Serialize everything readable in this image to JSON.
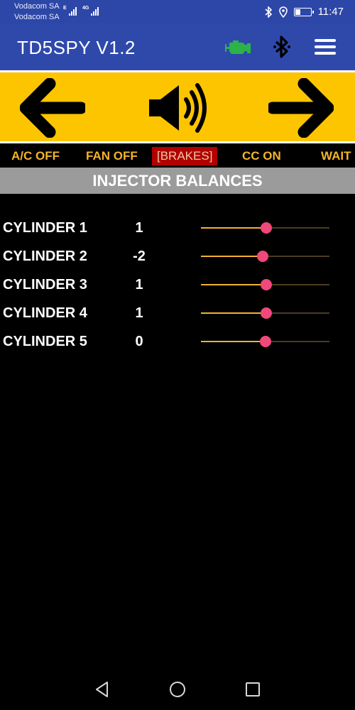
{
  "status_bar": {
    "carrier1": "Vodacom SA",
    "carrier2": "Vodacom SA",
    "network1": "E",
    "network2": "4G",
    "time": "11:47"
  },
  "app_bar": {
    "title": "TD5SPY V1.2",
    "engine_icon": "engine-check-icon",
    "bluetooth_icon": "bluetooth-icon",
    "menu_icon": "hamburger-menu-icon"
  },
  "controls": {
    "left": "left-arrow-icon",
    "sound": "speaker-icon",
    "right": "right-arrow-icon",
    "background": "#fdc500"
  },
  "toggles": [
    {
      "label": "A/C OFF",
      "active": false
    },
    {
      "label": "FAN OFF",
      "active": false
    },
    {
      "label": "[BRAKES]",
      "active": true
    },
    {
      "label": "CC ON",
      "active": false
    },
    {
      "label": "WAIT",
      "active": false
    }
  ],
  "section": {
    "title": "INJECTOR BALANCES"
  },
  "cylinders": [
    {
      "label": "CYLINDER 1",
      "value": "1",
      "slider_level": 0.51
    },
    {
      "label": "CYLINDER 2",
      "value": "-2",
      "slider_level": 0.48
    },
    {
      "label": "CYLINDER 3",
      "value": "1",
      "slider_level": 0.51
    },
    {
      "label": "CYLINDER 4",
      "value": "1",
      "slider_level": 0.51
    },
    {
      "label": "CYLINDER 5",
      "value": "0",
      "slider_level": 0.5
    }
  ],
  "colors": {
    "app_bar": "#2f49ab",
    "accent_text": "#f4b52b",
    "active_toggle": "#b10000",
    "slider_thumb": "#f0487a",
    "slider_fill": "#f2b134",
    "engine_icon": "#2bb34a"
  }
}
